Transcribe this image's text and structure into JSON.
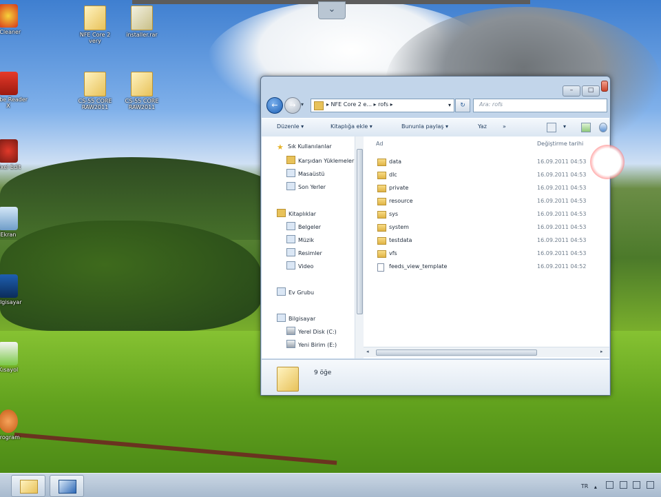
{
  "desktop": {
    "icons": [
      {
        "label": "CCleaner",
        "kind": "app"
      },
      {
        "label": "NFE Core 2 very",
        "kind": "folder"
      },
      {
        "label": "installer.rar",
        "kind": "archive"
      },
      {
        "label": "Adobe Reader X",
        "kind": "app"
      },
      {
        "label": "CS-55 CORE RAW2011",
        "kind": "folder"
      },
      {
        "label": "CS-55 CORE RAW2011",
        "kind": "folder"
      },
      {
        "label": "Pixel Edit",
        "kind": "app"
      },
      {
        "label": "Ekran",
        "kind": "app"
      },
      {
        "label": "Bilgisayar",
        "kind": "app"
      },
      {
        "label": "Kısayol",
        "kind": "app"
      },
      {
        "label": "Program",
        "kind": "app"
      }
    ]
  },
  "explorer": {
    "caption_buttons": {
      "minimize": "–",
      "maximize": "□",
      "close": "x"
    },
    "back_arrow": "←",
    "forward_arrow": "→",
    "breadcrumb": "▸ NFE Core 2 e... ▸ rofs ▸",
    "refresh_glyph": "↻",
    "search_placeholder": "Ara: rofs",
    "toolbar": {
      "organize": "Düzenle ▾",
      "add_to_library": "Kitaplığa ekle ▾",
      "share_with": "Bununla paylaş ▾",
      "burn": "Yaz",
      "more": "»"
    },
    "nav": {
      "favorites_header": "Sık Kullanılanlar",
      "favorites": [
        "Karşıdan Yüklemeler",
        "Masaüstü",
        "Son Yerler"
      ],
      "libraries_header": "Kitaplıklar",
      "libraries": [
        "Belgeler",
        "Müzik",
        "Resimler",
        "Video"
      ],
      "homegroup": "Ev Grubu",
      "computer_header": "Bilgisayar",
      "drives": [
        "Yerel Disk (C:)",
        "Yeni Birim (E:)"
      ]
    },
    "columns": {
      "name": "Ad",
      "modified": "Değiştirme tarihi"
    },
    "files": [
      {
        "name": "data",
        "date": "16.09.2011 04:53",
        "type": "folder"
      },
      {
        "name": "dlc",
        "date": "16.09.2011 04:53",
        "type": "folder"
      },
      {
        "name": "private",
        "date": "16.09.2011 04:53",
        "type": "folder"
      },
      {
        "name": "resource",
        "date": "16.09.2011 04:53",
        "type": "folder"
      },
      {
        "name": "sys",
        "date": "16.09.2011 04:53",
        "type": "folder"
      },
      {
        "name": "system",
        "date": "16.09.2011 04:53",
        "type": "folder"
      },
      {
        "name": "testdata",
        "date": "16.09.2011 04:53",
        "type": "folder"
      },
      {
        "name": "vfs",
        "date": "16.09.2011 04:53",
        "type": "folder"
      },
      {
        "name": "feeds_view_template",
        "date": "16.09.2011 04:52",
        "type": "file"
      }
    ],
    "status": {
      "item_count": "9 öğe"
    }
  },
  "taskbar": {
    "language": "TR",
    "tray_icons": [
      "arrow-up-icon",
      "flag-icon",
      "battery-icon",
      "network-icon",
      "volume-icon"
    ],
    "pinned": [
      "explorer-icon",
      "network-tool-icon"
    ]
  },
  "colors": {
    "accent": "#1b5fb5",
    "window_frame": "#c2d5ea",
    "folder_yellow": "#e8c25a"
  }
}
